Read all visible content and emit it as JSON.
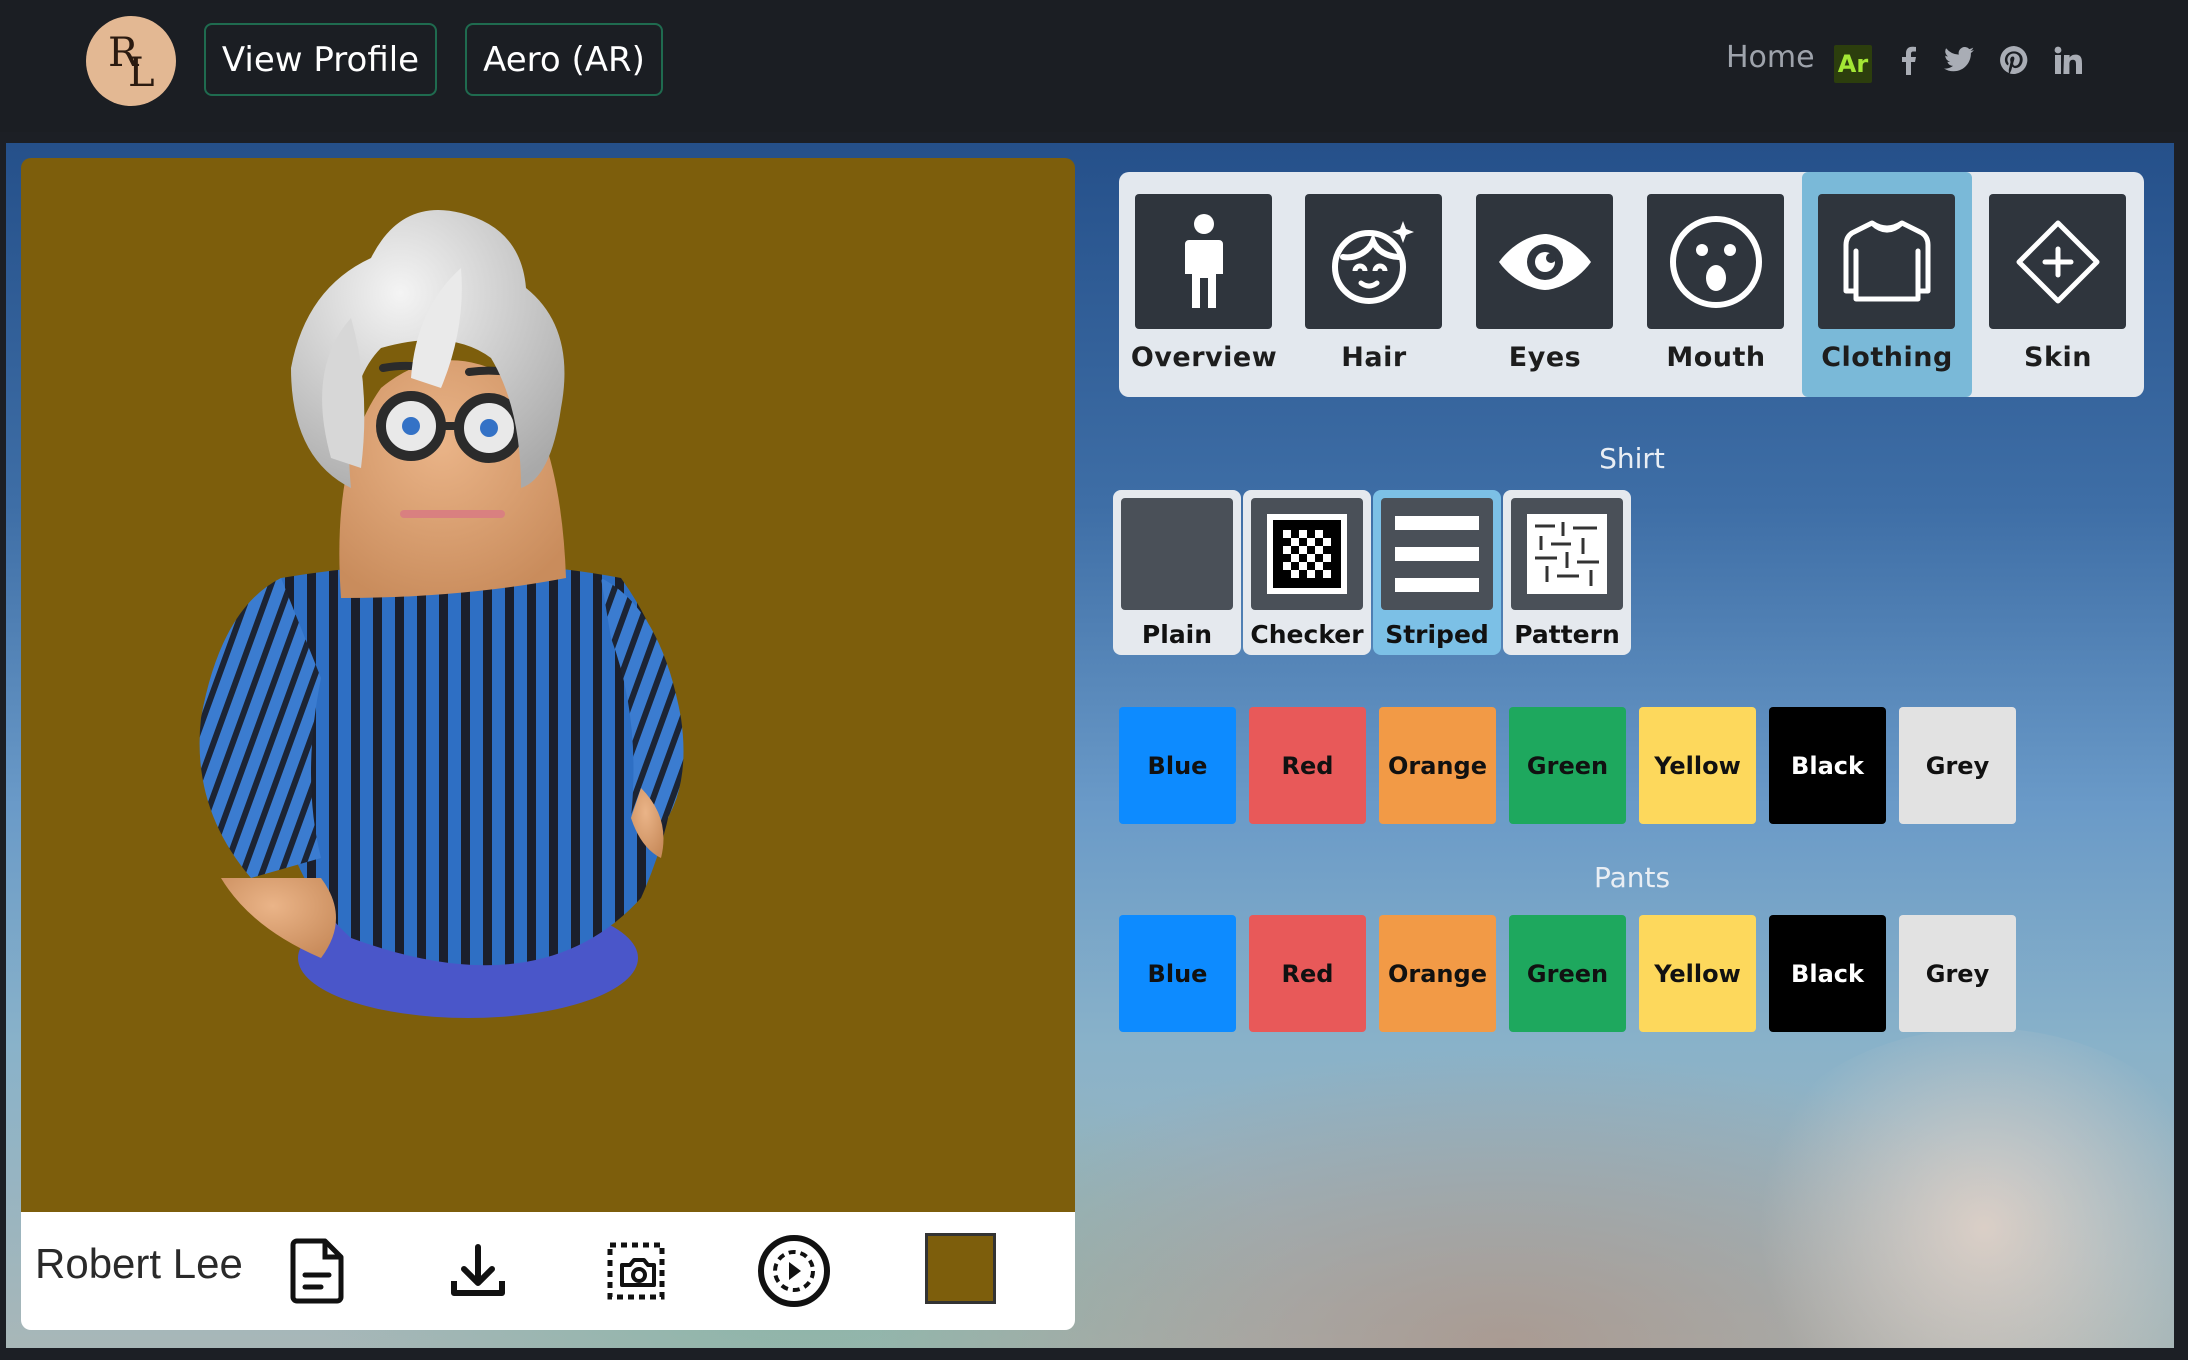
{
  "navbar": {
    "logo_line1": "R",
    "logo_line2": "L",
    "view_profile": "View Profile",
    "aero": "Aero (AR)",
    "home": "Home",
    "ar_badge": "Ar",
    "social_icons": [
      "facebook-icon",
      "twitter-icon",
      "pinterest-icon",
      "linkedin-icon"
    ]
  },
  "viewer": {
    "avatar_name": "Robert Lee",
    "background_color": "#7d5e0c",
    "toolbar_icons": [
      "document-icon",
      "download-icon",
      "screenshot-icon",
      "play-circle-icon",
      "background-color-swatch"
    ]
  },
  "categories": [
    {
      "label": "Overview",
      "icon": "person-icon",
      "active": false
    },
    {
      "label": "Hair",
      "icon": "hair-face-icon",
      "active": false
    },
    {
      "label": "Eyes",
      "icon": "eye-icon",
      "active": false
    },
    {
      "label": "Mouth",
      "icon": "surprised-face-icon",
      "active": false
    },
    {
      "label": "Clothing",
      "icon": "sweater-icon",
      "active": true
    },
    {
      "label": "Skin",
      "icon": "diamond-plus-icon",
      "active": false
    }
  ],
  "shirt": {
    "title": "Shirt",
    "styles": [
      {
        "label": "Plain",
        "active": false
      },
      {
        "label": "Checker",
        "active": false
      },
      {
        "label": "Striped",
        "active": true
      },
      {
        "label": "Pattern",
        "active": false
      }
    ],
    "colors": [
      {
        "label": "Blue",
        "hex": "#0d8bff"
      },
      {
        "label": "Red",
        "hex": "#e85959"
      },
      {
        "label": "Orange",
        "hex": "#f29a46"
      },
      {
        "label": "Green",
        "hex": "#1ea85e"
      },
      {
        "label": "Yellow",
        "hex": "#fdd85c"
      },
      {
        "label": "Black",
        "hex": "#000000"
      },
      {
        "label": "Grey",
        "hex": "#e2e2e2"
      }
    ]
  },
  "pants": {
    "title": "Pants",
    "colors": [
      {
        "label": "Blue",
        "hex": "#0d8bff"
      },
      {
        "label": "Red",
        "hex": "#e85959"
      },
      {
        "label": "Orange",
        "hex": "#f29a46"
      },
      {
        "label": "Green",
        "hex": "#1ea85e"
      },
      {
        "label": "Yellow",
        "hex": "#fdd85c"
      },
      {
        "label": "Black",
        "hex": "#000000"
      },
      {
        "label": "Grey",
        "hex": "#e2e2e2"
      }
    ]
  }
}
